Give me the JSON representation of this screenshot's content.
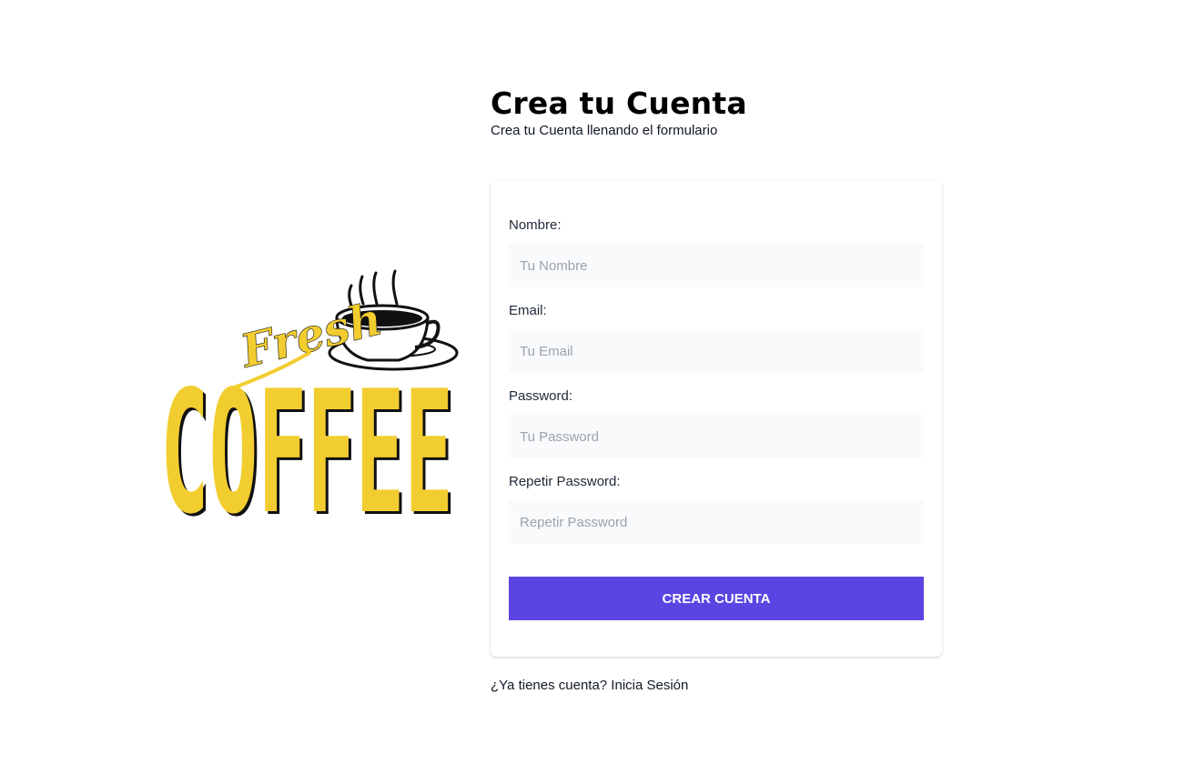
{
  "header": {
    "title": "Crea tu Cuenta",
    "subtitle": "Crea tu Cuenta llenando el formulario"
  },
  "logo": {
    "script_text": "Fresh",
    "main_text": "COFFEE",
    "colors": {
      "yellow": "#f2cd2f",
      "ink": "#111111"
    },
    "icon": "coffee-cup-icon"
  },
  "form": {
    "fields": [
      {
        "label": "Nombre:",
        "placeholder": "Tu Nombre",
        "value": ""
      },
      {
        "label": "Email:",
        "placeholder": "Tu Email",
        "value": ""
      },
      {
        "label": "Password:",
        "placeholder": "Tu Password",
        "value": ""
      },
      {
        "label": "Repetir Password:",
        "placeholder": "Repetir Password",
        "value": ""
      }
    ],
    "submit_label": "Crear Cuenta"
  },
  "footer": {
    "login_link": "¿Ya tienes cuenta? Inicia Sesión"
  },
  "colors": {
    "accent": "#5a45e3",
    "input_bg": "#f9fafb"
  }
}
